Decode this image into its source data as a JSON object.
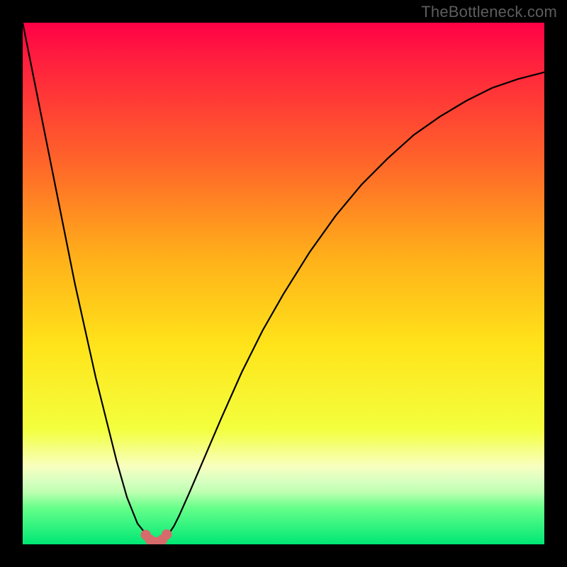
{
  "watermark": "TheBottleneck.com",
  "colors": {
    "black_border": "#000000",
    "curve_stroke": "#000000",
    "marker_fill": "#d76a6a",
    "gradient_stops": [
      "#ff0046",
      "#ff1a3f",
      "#ff6a28",
      "#ffb01a",
      "#ffe41a",
      "#f3ff3e",
      "#f8ffbf",
      "#d6ffc0",
      "#bdffb0",
      "#66ff8a",
      "#00e774"
    ]
  },
  "chart_data": {
    "type": "line",
    "title": "",
    "xlabel": "",
    "ylabel": "",
    "x": [
      0.0,
      0.02,
      0.04,
      0.06,
      0.08,
      0.1,
      0.12,
      0.14,
      0.16,
      0.18,
      0.2,
      0.22,
      0.24,
      0.248,
      0.255,
      0.262,
      0.27,
      0.28,
      0.29,
      0.3,
      0.32,
      0.35,
      0.38,
      0.42,
      0.46,
      0.5,
      0.55,
      0.6,
      0.65,
      0.7,
      0.75,
      0.8,
      0.85,
      0.9,
      0.95,
      1.0
    ],
    "y": [
      100,
      90,
      80,
      70,
      60,
      50,
      41,
      32,
      24,
      16,
      9,
      4,
      1.5,
      0.6,
      0.3,
      0.4,
      0.9,
      2.0,
      3.5,
      5.5,
      10,
      17,
      24,
      33,
      41,
      48,
      56,
      63,
      69,
      74,
      78.5,
      82,
      85,
      87.5,
      89.2,
      90.5
    ],
    "xlim": [
      0,
      1
    ],
    "ylim": [
      0,
      100
    ],
    "markers": {
      "x": [
        0.236,
        0.244,
        0.252,
        0.26,
        0.268,
        0.276
      ],
      "y": [
        1.8,
        0.9,
        0.45,
        0.45,
        0.9,
        1.9
      ]
    }
  }
}
